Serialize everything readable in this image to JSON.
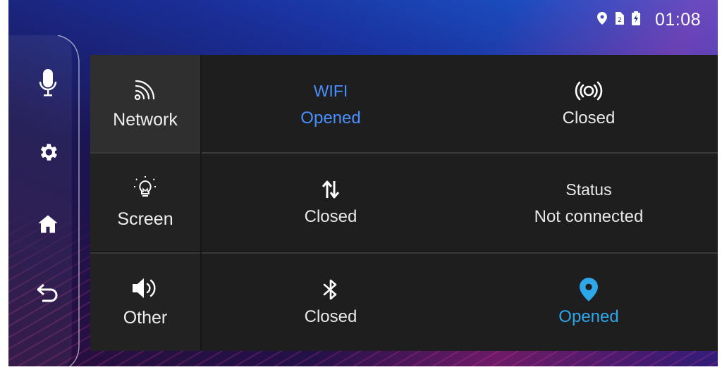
{
  "status_bar": {
    "time": "01:08",
    "icons": [
      "location-icon",
      "sim-icon",
      "battery-icon"
    ]
  },
  "sidebar": {
    "items": [
      {
        "icon": "microphone-icon"
      },
      {
        "icon": "gear-icon"
      },
      {
        "icon": "home-icon"
      },
      {
        "icon": "back-icon"
      }
    ]
  },
  "categories": [
    {
      "label": "Network",
      "icon": "wifi-signal-icon",
      "active": true
    },
    {
      "label": "Screen",
      "icon": "lightbulb-icon",
      "active": false
    },
    {
      "label": "Other",
      "icon": "speaker-icon",
      "active": false
    }
  ],
  "tiles": {
    "wifi": {
      "title": "WIFI",
      "state": "Opened"
    },
    "hotspot": {
      "icon": "hotspot-icon",
      "state": "Closed"
    },
    "data": {
      "icon": "data-transfer-icon",
      "state": "Closed"
    },
    "status": {
      "title": "Status",
      "state": "Not connected"
    },
    "bluetooth": {
      "icon": "bluetooth-icon",
      "state": "Closed"
    },
    "location": {
      "icon": "location-pin-icon",
      "state": "Opened"
    }
  },
  "colors": {
    "accent_blue": "#4a8fff",
    "accent_cyan": "#2ea6ea"
  }
}
